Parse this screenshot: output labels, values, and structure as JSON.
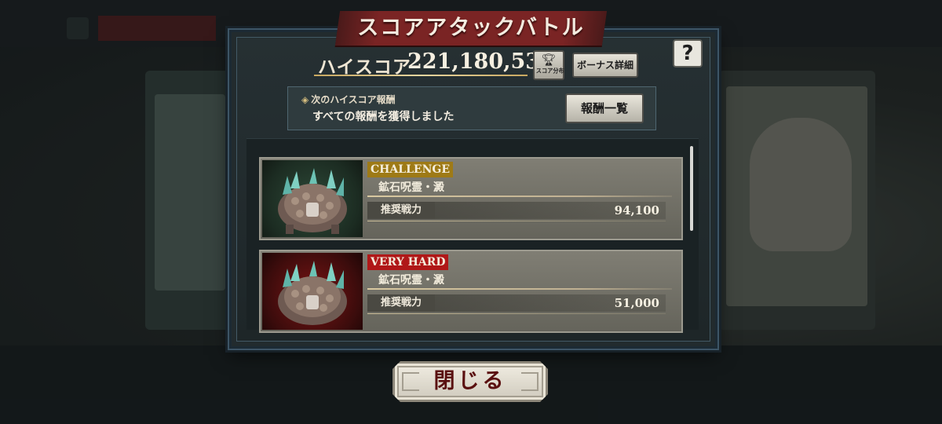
{
  "title": "スコアアタックバトル",
  "help_label": "?",
  "high_score": {
    "label": "ハイスコア",
    "value": "221,180,535"
  },
  "score_dist_button": {
    "icon": "trophy-icon",
    "label": "スコア分布"
  },
  "bonus_button_label": "ボーナス詳細",
  "next_reward": {
    "title": "次のハイスコア報酬",
    "status": "すべての報酬を獲得しました",
    "list_button_label": "報酬一覧"
  },
  "battles": [
    {
      "difficulty": "CHALLENGE",
      "difficulty_color": "#9e7a16",
      "boss_name": "鉱石呪霊・澱",
      "power_label": "推奨戦力",
      "power_value": "94,100"
    },
    {
      "difficulty": "VERY HARD",
      "difficulty_color": "#b01818",
      "boss_name": "鉱石呪霊・澱",
      "power_label": "推奨戦力",
      "power_value": "51,000"
    }
  ],
  "close_button_label": "閉じる"
}
